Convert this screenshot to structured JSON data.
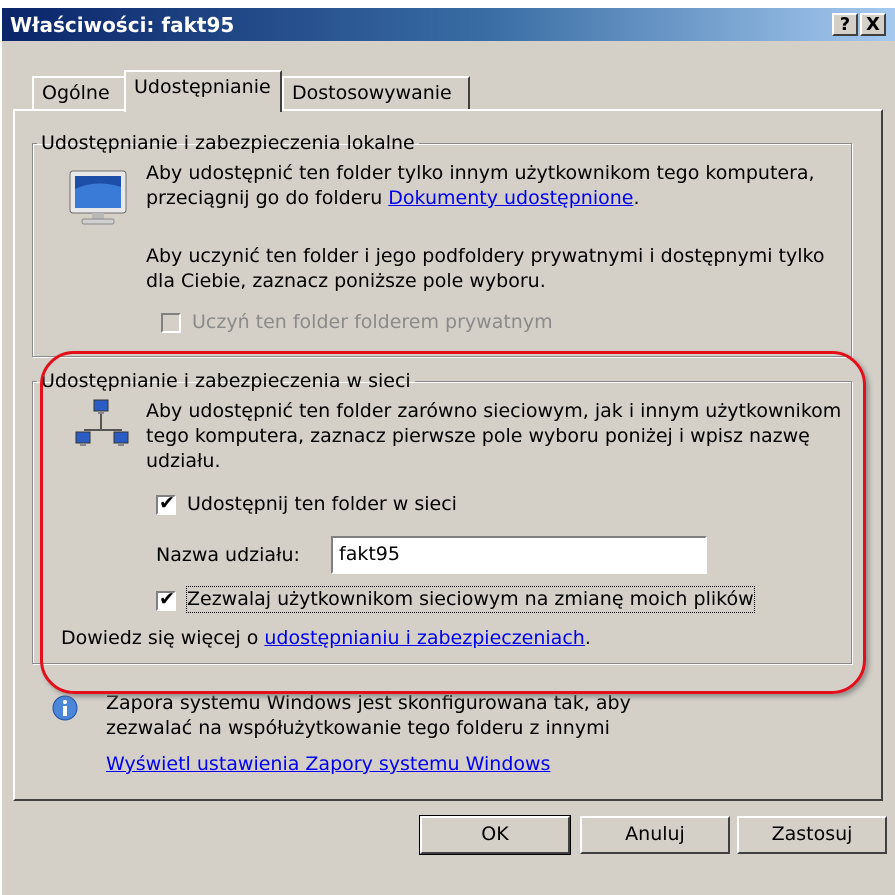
{
  "window": {
    "title": "Właściwości: fakt95",
    "help_button": "?",
    "close_button": "X"
  },
  "tabs": [
    {
      "label": "Ogólne",
      "active": false
    },
    {
      "label": "Udostępnianie",
      "active": true
    },
    {
      "label": "Dostosowywanie",
      "active": false
    }
  ],
  "local_group": {
    "title": "Udostępnianie i zabezpieczenia lokalne",
    "para1_line1": "Aby udostępnić ten folder tylko innym użytkownikom tego komputera,",
    "para1_line2_prefix": "przeciągnij go do folderu ",
    "para1_link": "Dokumenty udostępnione",
    "para1_line2_suffix": ".",
    "para2_line1": "Aby uczynić ten folder i jego podfoldery prywatnymi i dostępnymi tylko",
    "para2_line2": "dla Ciebie, zaznacz poniższe pole wyboru.",
    "private_checkbox_label": "Uczyń ten folder folderem prywatnym",
    "private_checkbox_checked": false,
    "private_checkbox_enabled": false
  },
  "network_group": {
    "title": "Udostępnianie i zabezpieczenia w sieci",
    "para_line1": "Aby udostępnić ten folder zarówno sieciowym, jak i innym użytkownikom",
    "para_line2": "tego komputera, zaznacz pierwsze pole wyboru poniżej i wpisz nazwę",
    "para_line3": "udziału.",
    "share_checkbox_label": "Udostępnij ten folder w sieci",
    "share_checkbox_checked": true,
    "share_name_label": "Nazwa udziału:",
    "share_name_value": "fakt95",
    "allow_change_label": "Zezwalaj użytkownikom sieciowym na zmianę moich plików",
    "allow_change_checked": true,
    "learn_more_prefix": "Dowiedz się więcej o ",
    "learn_more_link": "udostępnianiu i zabezpieczeniach",
    "learn_more_suffix": "."
  },
  "firewall_info": {
    "line1": "Zapora systemu Windows jest skonfigurowana tak, aby",
    "line2": "zezwalać na współużytkowanie tego folderu z innymi",
    "link": "Wyświetl ustawienia Zapory systemu Windows"
  },
  "buttons": {
    "ok": "OK",
    "cancel": "Anuluj",
    "apply": "Zastosuj"
  },
  "icons": [
    "help-icon",
    "close-icon",
    "monitor-icon",
    "network-icon",
    "info-icon",
    "checkmark-icon"
  ],
  "colors": {
    "titlebar_start": "#0a246a",
    "titlebar_end": "#a6caf0",
    "dialog_bg": "#d4d0c8",
    "link": "#0000ee",
    "highlight_ring": "#e3101b"
  }
}
